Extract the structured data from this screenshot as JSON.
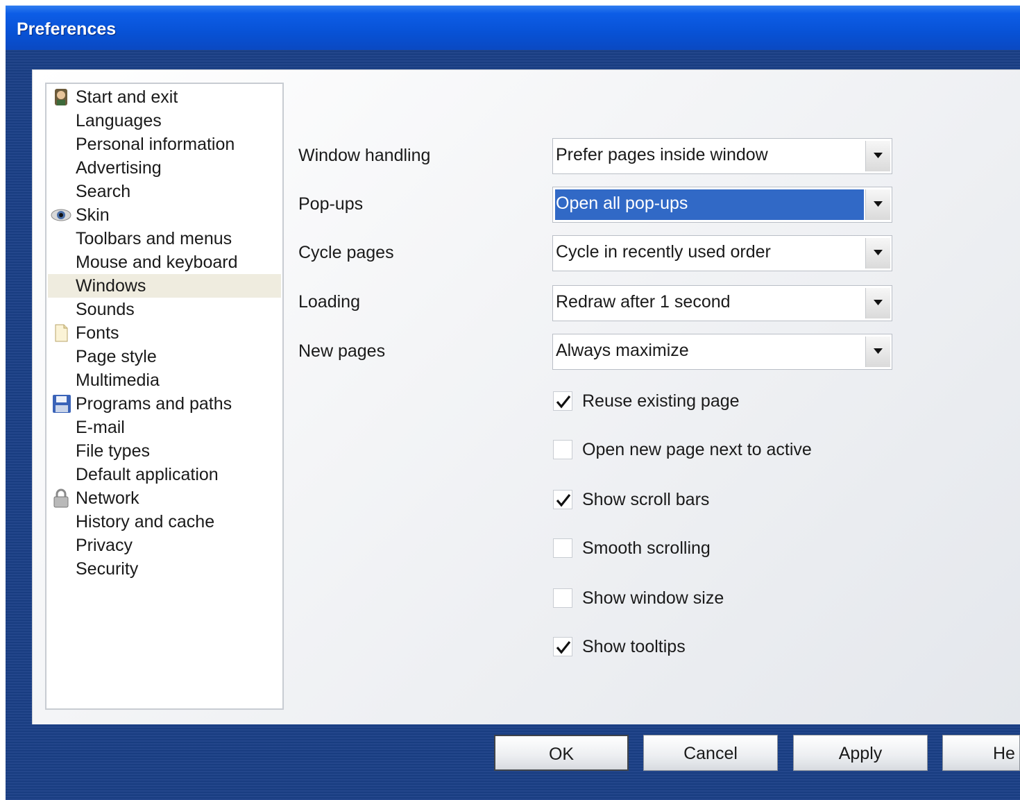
{
  "window": {
    "title": "Preferences"
  },
  "sidebar": {
    "items": [
      {
        "label": "Start and exit",
        "icon": "person-icon"
      },
      {
        "label": "Languages"
      },
      {
        "label": "Personal information"
      },
      {
        "label": "Advertising"
      },
      {
        "label": "Search"
      },
      {
        "label": "Skin",
        "icon": "eye-icon"
      },
      {
        "label": "Toolbars and menus"
      },
      {
        "label": "Mouse and keyboard"
      },
      {
        "label": "Windows",
        "selected": true
      },
      {
        "label": "Sounds"
      },
      {
        "label": "Fonts",
        "icon": "document-icon"
      },
      {
        "label": "Page style"
      },
      {
        "label": "Multimedia"
      },
      {
        "label": "Programs and paths",
        "icon": "floppy-disk-icon"
      },
      {
        "label": "E-mail"
      },
      {
        "label": "File types"
      },
      {
        "label": "Default application"
      },
      {
        "label": "Network",
        "icon": "padlock-icon"
      },
      {
        "label": "History and cache"
      },
      {
        "label": "Privacy"
      },
      {
        "label": "Security"
      }
    ]
  },
  "settings": {
    "fields": [
      {
        "label": "Window handling",
        "value": "Prefer pages inside window"
      },
      {
        "label": "Pop-ups",
        "value": "Open all pop-ups",
        "highlighted": true
      },
      {
        "label": "Cycle pages",
        "value": "Cycle in recently used order"
      },
      {
        "label": "Loading",
        "value": "Redraw after 1 second"
      },
      {
        "label": "New pages",
        "value": "Always maximize"
      }
    ],
    "checkboxes": [
      {
        "label": "Reuse existing page",
        "checked": true
      },
      {
        "label": "Open new page next to active",
        "checked": false
      },
      {
        "label": "Show scroll bars",
        "checked": true
      },
      {
        "label": "Smooth scrolling",
        "checked": false
      },
      {
        "label": "Show window size",
        "checked": false
      },
      {
        "label": "Show tooltips",
        "checked": true
      }
    ]
  },
  "buttons": {
    "ok": "OK",
    "cancel": "Cancel",
    "apply": "Apply",
    "help": "He"
  },
  "colors": {
    "titlebar": "#0852d6",
    "frame": "#1a3f86",
    "selection": "#3169c6",
    "selected_nav": "#efecdf"
  }
}
